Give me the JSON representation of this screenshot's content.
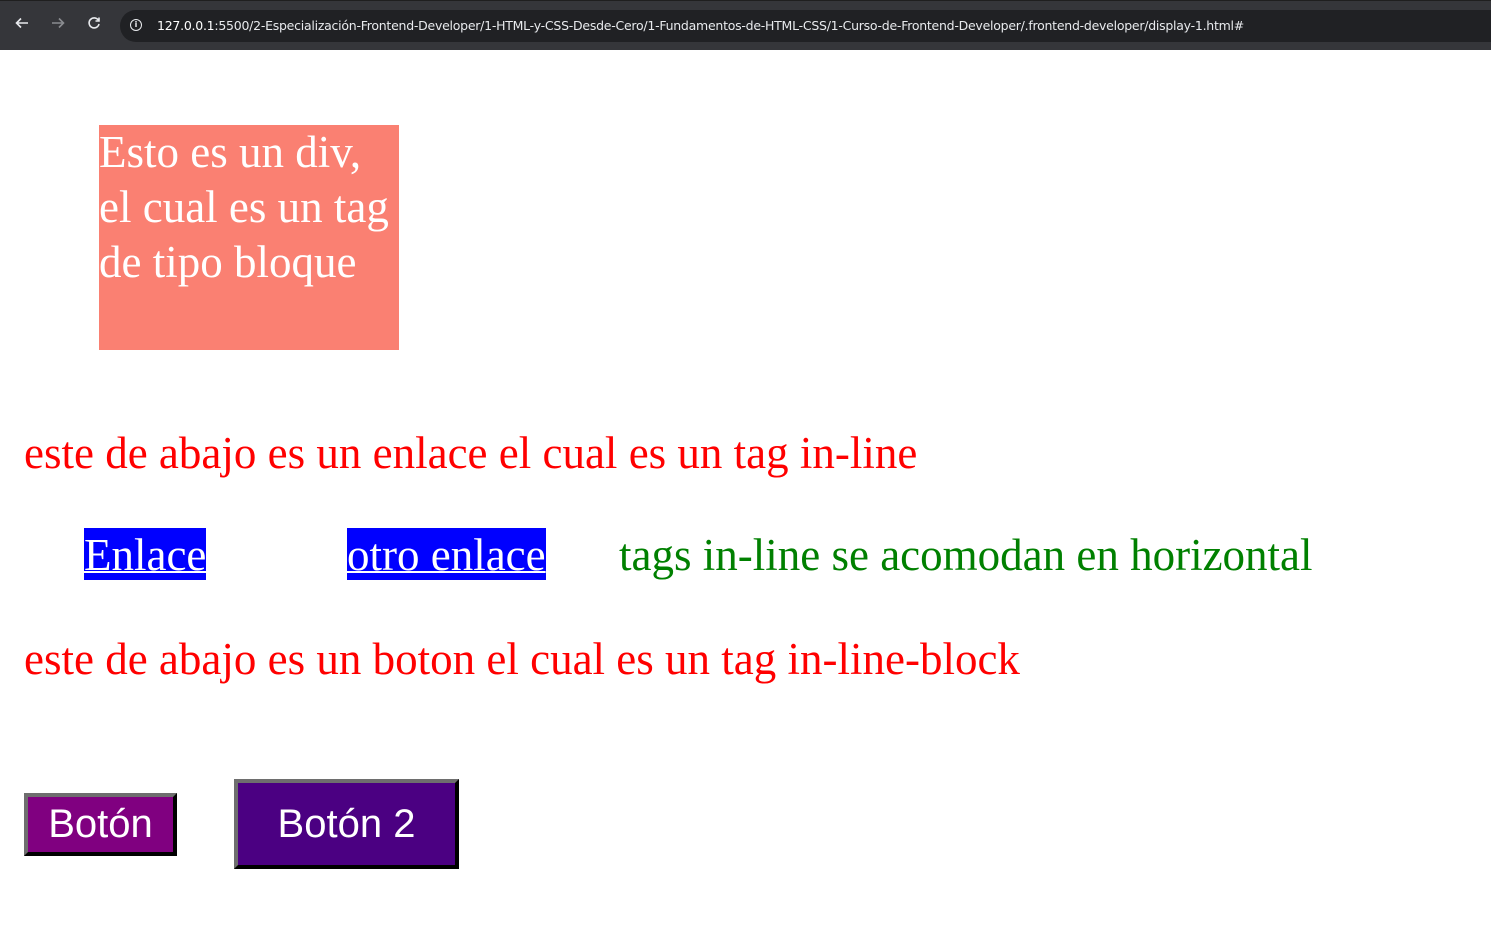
{
  "browser": {
    "back_icon": "arrow-left-icon",
    "forward_icon": "arrow-right-icon",
    "reload_icon": "reload-icon",
    "site_info_icon": "info-icon",
    "url_host": "127.0.0.1",
    "url_path": ":5500/2-Especialización-Frontend-Developer/1-HTML-y-CSS-Desde-Cero/1-Fundamentos-de-HTML-CSS/1-Curso-de-Frontend-Developer/.frontend-developer/display-1.html#"
  },
  "page": {
    "block_div_text": "Esto es un div, el cual es un tag de tipo bloque",
    "inline_heading": "este de abajo es un enlace el cual es un tag in-line",
    "link_1": "Enlace",
    "link_2": "otro enlace",
    "inline_note": "tags in-line se acomodan en horizontal",
    "inline_block_heading": "este de abajo es un boton el cual es un tag in-line-block",
    "button_1": "Botón",
    "button_2": "Botón 2"
  },
  "colors": {
    "div_background": "#fa8072",
    "heading_text": "#ff0000",
    "link_background": "#0000ff",
    "note_text": "#008000",
    "button_1_background": "#800080",
    "button_2_background": "#4b0082"
  }
}
